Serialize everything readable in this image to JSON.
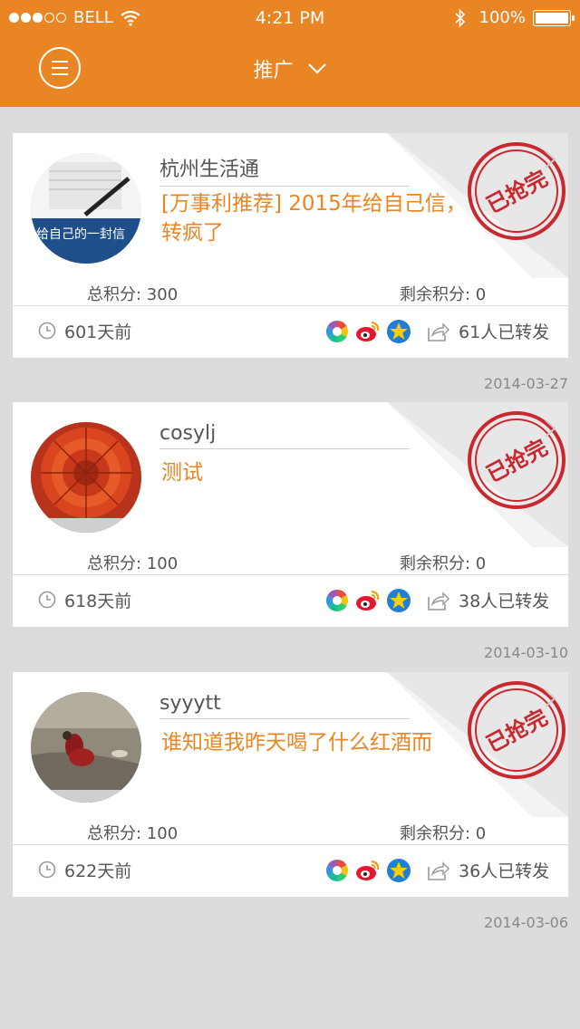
{
  "status_bar": {
    "carrier": "BELL",
    "time": "4:21 PM",
    "battery": "100%"
  },
  "nav": {
    "title": "推广"
  },
  "labels": {
    "total_prefix": "总积分: ",
    "remain_prefix": "剩余积分: ",
    "ago_suffix": "天前",
    "forward_suffix": "人已转发",
    "stamp_text": "已抢完"
  },
  "posts": [
    {
      "name": "杭州生活通",
      "description": "[万事利推荐]  2015年给自己信，转疯了",
      "total": "总积分: 300",
      "remain": "剩余积分: 0",
      "ago": "601天前",
      "forwards": "61人已转发",
      "date": "2014-03-27",
      "avatar_text": "给自己的一封信",
      "stamp": "已抢完"
    },
    {
      "name": "cosylj",
      "description": "测试",
      "total": "总积分: 100",
      "remain": "剩余积分: 0",
      "ago": "618天前",
      "forwards": "38人已转发",
      "date": "2014-03-10",
      "stamp": "已抢完"
    },
    {
      "name": "syyytt",
      "description": "谁知道我昨天喝了什么红酒而",
      "total": "总积分: 100",
      "remain": "剩余积分: 0",
      "ago": "622天前",
      "forwards": "36人已转发",
      "date": "2014-03-06",
      "stamp": "已抢完"
    }
  ],
  "colors": {
    "accent": "#ea8524",
    "background": "#dcdcdc",
    "stamp": "#c8282e"
  },
  "icons": [
    "wifi-icon",
    "bluetooth-icon",
    "battery-icon",
    "menu-icon",
    "chevron-down-icon",
    "clock-icon",
    "wechat-moments-icon",
    "weibo-icon",
    "qzone-icon",
    "forward-icon",
    "chevron-right-icon"
  ]
}
